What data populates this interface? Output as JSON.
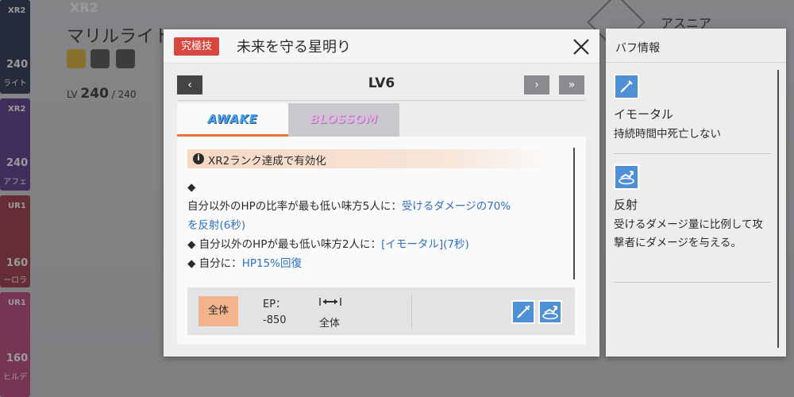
{
  "background": {
    "rank_title": "XR2",
    "char_name": "マリルライト",
    "level_prefix": "LV",
    "level": "240",
    "level_max": "/ 240",
    "right_name": "アスニア",
    "cards": [
      {
        "rank": "XR2",
        "level": "240",
        "name": "ライト",
        "color": "#2c3552"
      },
      {
        "rank": "XR2",
        "level": "240",
        "name": "アフェ",
        "color": "#5a3a8a"
      },
      {
        "rank": "UR1",
        "level": "160",
        "name": "ーロラ",
        "color": "#a23a4a"
      },
      {
        "rank": "UR1",
        "level": "160",
        "name": "ヒルデ",
        "color": "#c0477c"
      }
    ]
  },
  "dialog": {
    "skill_type": "究極技",
    "skill_name": "未来を守る星明り",
    "close_icon": "close-icon",
    "level": {
      "label": "LV6",
      "prev": "‹",
      "next": "›",
      "max": "»"
    },
    "tabs": [
      {
        "label": "AWAKE",
        "active": true
      },
      {
        "label": "BLOSSOM",
        "active": false
      }
    ],
    "unlock_note": "XR2ランク達成で有効化",
    "description": {
      "line0": "◆",
      "line1_plain": "自分以外のHPの比率が最も低い味方5人に：",
      "line1_hl": "受けるダメージの70%",
      "line2_hl": "を反射(6秒)",
      "line3_plain": "◆ 自分以外のHPが最も低い味方2人に：",
      "line3_hl": "[イモータル](7秒)",
      "line4_plain": "◆ 自分に：",
      "line4_hl": "HP15%回復"
    },
    "stats": {
      "target": "全体",
      "ep_label": "EP：",
      "ep_value": "-850",
      "range_value": "全体",
      "range_icon": "range-arrow-icon",
      "buff_icons": [
        "immortal-buff-icon",
        "reflect-buff-icon"
      ]
    }
  },
  "buff_panel": {
    "title": "バフ情報",
    "items": [
      {
        "icon": "immortal-buff-icon",
        "name": "イモータル",
        "desc": "持続時間中死亡しない"
      },
      {
        "icon": "reflect-buff-icon",
        "name": "反射",
        "desc": "受けるダメージ量に比例して攻撃者にダメージを与える。"
      }
    ]
  },
  "colors": {
    "skill_type_bg": "#d8473f",
    "highlight_text": "#2f6fc2",
    "tab_active_border": "#e8783a",
    "buff_icon_bg": "#4f8fd6",
    "target_tag_bg": "#f2b38d"
  }
}
